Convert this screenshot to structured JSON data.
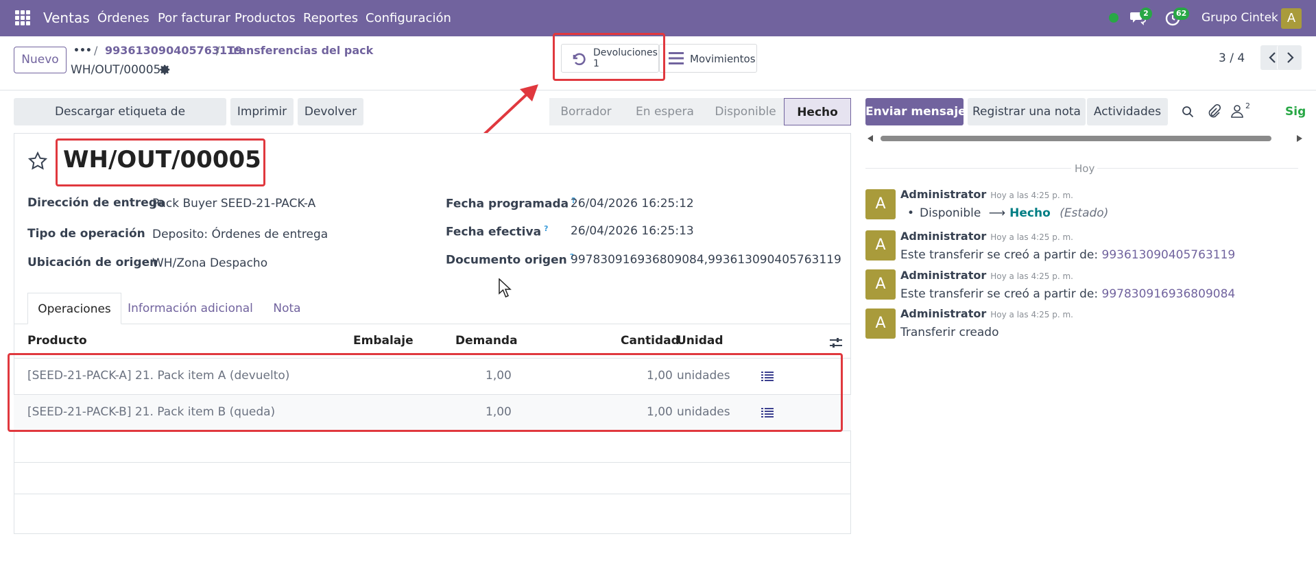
{
  "topnav": {
    "app_name": "Ventas",
    "menu": [
      "Órdenes",
      "Por facturar",
      "Productos",
      "Reportes",
      "Configuración"
    ],
    "messages_count": "2",
    "activities_count": "62",
    "company": "Grupo Cintek",
    "user_initial": "A"
  },
  "control": {
    "new_label": "Nuevo",
    "breadcrumb_more": "•••",
    "breadcrumb": [
      "993613090405763119",
      "Transferencias del pack"
    ],
    "record_name": "WH/OUT/00005",
    "stat_returns_label": "Devoluciones",
    "stat_returns_count": "1",
    "stat_moves_label": "Movimientos",
    "pager": "3 / 4"
  },
  "actions": {
    "download_label": "Descargar etiqueta de MercadoLibre",
    "print_label": "Imprimir",
    "return_label": "Devolver"
  },
  "stages": [
    "Borrador",
    "En espera",
    "Disponible",
    "Hecho"
  ],
  "active_stage": "Hecho",
  "form": {
    "title": "WH/OUT/00005",
    "left_fields": [
      {
        "label": "Dirección de entrega",
        "value": "Pack Buyer SEED-21-PACK-A"
      },
      {
        "label": "Tipo de operación",
        "value": "Deposito: Órdenes de entrega"
      },
      {
        "label": "Ubicación de origen",
        "value": "WH/Zona Despacho"
      }
    ],
    "right_fields": [
      {
        "label": "Fecha programada",
        "value": "26/04/2026 16:25:12"
      },
      {
        "label": "Fecha efectiva",
        "value": "26/04/2026 16:25:13"
      },
      {
        "label": "Documento origen",
        "value": "997830916936809084,993613090405763119"
      }
    ],
    "help_mark": "?",
    "tabs": [
      "Operaciones",
      "Información adicional",
      "Nota"
    ],
    "table": {
      "columns": [
        "Producto",
        "Embalaje",
        "Demanda",
        "Cantidad",
        "Unidad"
      ],
      "rows": [
        {
          "product": "[SEED-21-PACK-A] 21. Pack item A (devuelto)",
          "demand": "1,00",
          "qty": "1,00",
          "unit": "unidades"
        },
        {
          "product": "[SEED-21-PACK-B] 21. Pack item B (queda)",
          "demand": "1,00",
          "qty": "1,00",
          "unit": "unidades"
        }
      ]
    }
  },
  "chatter": {
    "send_label": "Enviar mensaje",
    "note_label": "Registrar una nota",
    "activities_label": "Actividades",
    "followers_count": "2",
    "follow_label": "Sig",
    "date_separator": "Hoy",
    "messages": [
      {
        "author": "Administrator",
        "time": "Hoy a las 4:25 p. m.",
        "from": "Disponible",
        "to": "Hecho",
        "field": "(Estado)"
      },
      {
        "author": "Administrator",
        "time": "Hoy a las 4:25 p. m.",
        "text": "Este transferir se creó a partir de:",
        "link": "993613090405763119"
      },
      {
        "author": "Administrator",
        "time": "Hoy a las 4:25 p. m.",
        "text": "Este transferir se creó a partir de:",
        "link": "997830916936809084"
      },
      {
        "author": "Administrator",
        "time": "Hoy a las 4:25 p. m.",
        "text": "Transferir creado"
      }
    ]
  },
  "colors": {
    "brand": "#71639e",
    "annotation": "#e0383e",
    "online": "#28a745"
  }
}
